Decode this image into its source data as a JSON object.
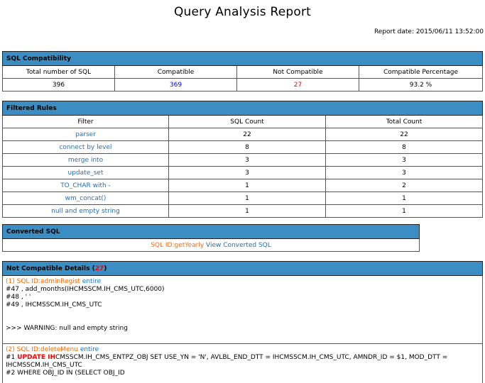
{
  "title": "Query Analysis Report",
  "report_date": "Report date: 2015/06/11 13:52:00",
  "compatibility": {
    "header": "SQL Compatibility",
    "columns": [
      "Total number of SQL",
      "Compatible",
      "Not Compatible",
      "Compatible Percentage"
    ],
    "values": {
      "total": "396",
      "compatible": "369",
      "not_compatible": "27",
      "percentage": "93.2 %"
    }
  },
  "filtered_rules": {
    "header": "Filtered Rules",
    "columns": [
      "Filter",
      "SQL Count",
      "Total Count"
    ],
    "rows": [
      {
        "filter": "parser",
        "sql_count": "22",
        "total_count": "22"
      },
      {
        "filter": "connect by level",
        "sql_count": "8",
        "total_count": "8"
      },
      {
        "filter": "merge into",
        "sql_count": "3",
        "total_count": "3"
      },
      {
        "filter": "update_set",
        "sql_count": "3",
        "total_count": "3"
      },
      {
        "filter": "TO_CHAR with -",
        "sql_count": "1",
        "total_count": "2"
      },
      {
        "filter": "wm_concat()",
        "sql_count": "1",
        "total_count": "1"
      },
      {
        "filter": "null and empty string",
        "sql_count": "1",
        "total_count": "1"
      }
    ]
  },
  "converted_sql": {
    "header": "Converted SQL",
    "sql_id": "SQL ID:getYearly",
    "link": "View Converted SQL"
  },
  "not_compatible": {
    "header": "Not Compatible Details (",
    "count": "27",
    "header_end": ")",
    "details": [
      {
        "id_label": "(1) SQL ID:adminRegist",
        "entire": "entire",
        "lines": [
          "#47 , add_months(IHCMSSCM.IH_CMS_UTC,6000)",
          "#48 , ' '",
          "#49 , IHCMSSCM.IH_CMS_UTC"
        ],
        "warning": ">>> WARNING: null and empty string"
      },
      {
        "id_label": "(2) SQL ID:deleteMenu",
        "entire": "entire",
        "line1_prefix": "#1 ",
        "line1_keyword": "UPDATE IH",
        "line1_rest": "CMSSCM.IH_CMS_ENTPZ_OBJ SET USE_YN = 'N', AVLBL_END_DTT = IHCMSSCM.IH_CMS_UTC, AMNDR_ID = $1, MOD_DTT = IHCMSSCM.IH_CMS_UTC",
        "line2": "#2 WHERE OBJ_ID IN (SELECT OBJ_ID"
      }
    ]
  },
  "colors": {
    "header_bg": "#3b8ec4",
    "compatible": "#0000ff",
    "not_compatible": "#ff0000",
    "link": "#1a6fc2",
    "sql_id": "#ff6a00"
  }
}
